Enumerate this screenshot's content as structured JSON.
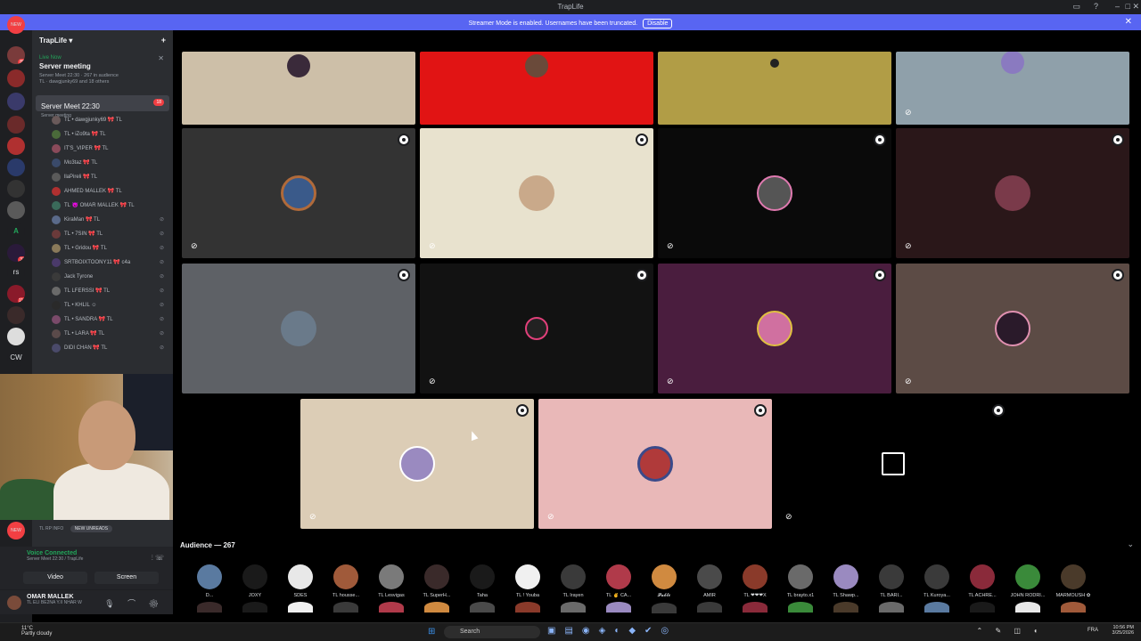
{
  "window": {
    "title": "TrapLife"
  },
  "banner": {
    "text": "Streamer Mode is enabled. Usernames have been truncated.",
    "button": "Disable"
  },
  "server": {
    "name": "TrapLife"
  },
  "rail": {
    "badge_new": "NEW",
    "badge_new2": "NEW",
    "letters": {
      "a": "A",
      "rs": "rs",
      "cw": "CW"
    },
    "counts": {
      "c1": "88",
      "c2": "31",
      "c3": "116"
    }
  },
  "live_event": {
    "status": "Live Now",
    "name": "Server meeting",
    "meta": "Server Meet 22:30 · 267 in audience",
    "meta2": "TL · dawgjunky69 and 18 others"
  },
  "stage_channel": {
    "name": "Server Meet 22:30",
    "subtitle": "Server meeting",
    "count": "18"
  },
  "members": [
    {
      "name": "TL • dawgjunky69 🎀 TL"
    },
    {
      "name": "TL • iZo9ta 🎀 TL"
    },
    {
      "name": "IT'S_VIPER 🎀 TL"
    },
    {
      "name": "Mo3taz 🎀 TL"
    },
    {
      "name": "llaPireli 🎀 TL"
    },
    {
      "name": "AHMED MALLEK 🎀 TL"
    },
    {
      "name": "TL 😈 OMAR MALLEK 🎀 TL"
    },
    {
      "name": "KiraMan 🎀 TL"
    },
    {
      "name": "TL • 7SIN 🎀 TL"
    },
    {
      "name": "TL • Gridou 🎀 TL"
    },
    {
      "name": "SRTBOIXTOONY11 🎀 c4a"
    },
    {
      "name": "Jack Tyrone"
    },
    {
      "name": "TL LFERSSI 🎀 TL"
    },
    {
      "name": "TL • KHLIL ☺"
    },
    {
      "name": "TL • SANDRA 🎀 TL"
    },
    {
      "name": "TL • LARA 🎀 TL"
    },
    {
      "name": "DIDI CHAN 🎀 TL"
    }
  ],
  "notice": {
    "channel": "TL RP INFO",
    "pill": "NEW UNREADS"
  },
  "voice": {
    "status": "Voice Connected",
    "sub": "Server Meet 22:30 / TrapLife",
    "video": "Video",
    "screen": "Screen"
  },
  "user": {
    "name": "OMAR MALLEK",
    "status": "TL ELI BE2NA Y.II NHAR W"
  },
  "audience": {
    "header": "Audience — 267",
    "people": [
      "D...",
      "JOXY",
      "SDES",
      "TL houssе...",
      "TL Lesvigas",
      "TL SuperH...",
      "Taha",
      "TL ! Youba",
      "TL Irayen",
      "TL ✌ CA...",
      "𝓟𝓪𝓫𝓵𝓸",
      "AMIR",
      "TL ❤❤❤X",
      "TL brayto.x1",
      "TL Shawp...",
      "TL BARI...",
      "TL Kuroya...",
      "TL ACHRE...",
      "JOHN RODRI...",
      "MARMOUSH ✿"
    ]
  },
  "taskbar": {
    "temp": "11°C",
    "weather": "Partly cloudy",
    "search": "Search",
    "lang": "FRA",
    "time": "10:56 PM",
    "date": "3/25/2026"
  },
  "colors": {
    "accent": "#5865f2",
    "live": "#23a55a",
    "danger": "#f23f43"
  }
}
